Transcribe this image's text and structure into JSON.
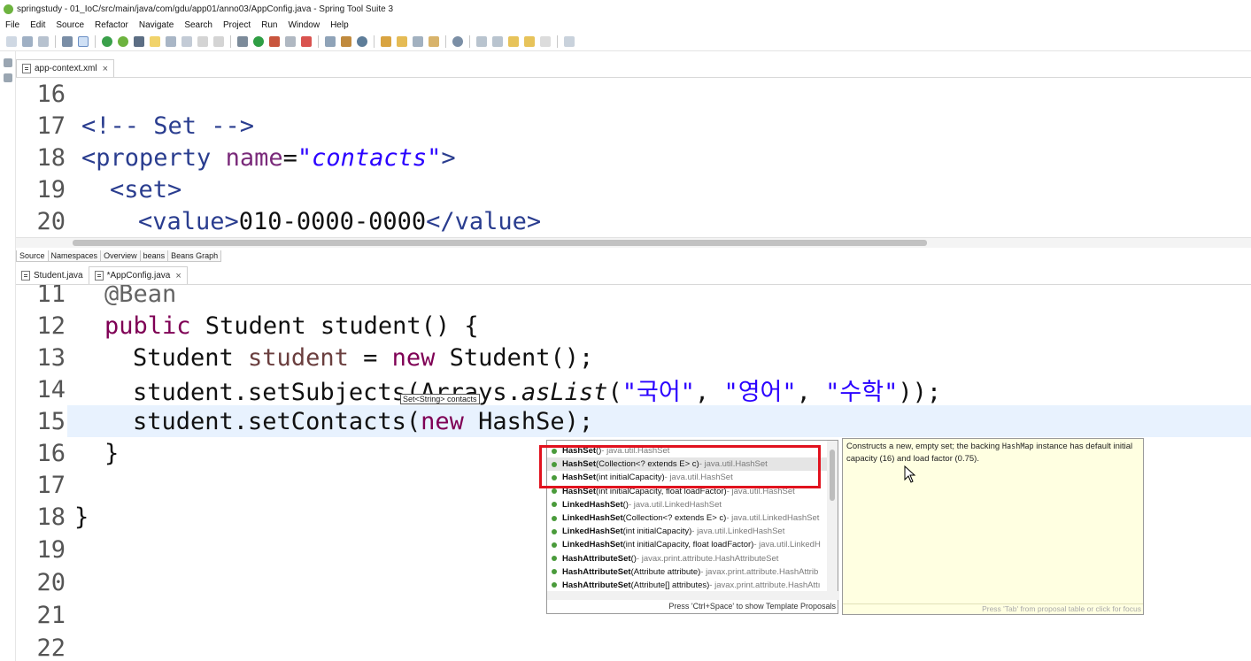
{
  "window": {
    "title": "springstudy - 01_IoC/src/main/java/com/gdu/app01/anno03/AppConfig.java - Spring Tool Suite 3"
  },
  "menu": [
    "File",
    "Edit",
    "Source",
    "Refactor",
    "Navigate",
    "Search",
    "Project",
    "Run",
    "Window",
    "Help"
  ],
  "top_editor": {
    "tab_label": "app-context.xml",
    "lines": [
      {
        "no": "16"
      },
      {
        "no": "17",
        "c1": "<!-- Set -->"
      },
      {
        "no": "18",
        "c1": "<property ",
        "c2": "name",
        "c3": "=",
        "c4": "\"contacts\"",
        "c5": ">"
      },
      {
        "no": "19",
        "c1": "<set>"
      },
      {
        "no": "20",
        "c1": "<value>",
        "c2": "010-0000-0000",
        "c3": "</value>"
      }
    ]
  },
  "design_tabs": [
    "Source",
    "Namespaces",
    "Overview",
    "beans",
    "Beans Graph"
  ],
  "bottom_tabs": [
    {
      "label": "Student.java",
      "active": false
    },
    {
      "label": "*AppConfig.java",
      "active": true
    }
  ],
  "java_lines": [
    {
      "no": "11",
      "anno": "@Bean"
    },
    {
      "no": "12",
      "kw": "public",
      "rest": " Student student() {"
    },
    {
      "no": "13",
      "t1": "Student ",
      "var": "student",
      "t2": " = ",
      "kw": "new",
      "t3": " Student();"
    },
    {
      "no": "14",
      "t1": "student.setSubjects(Arrays.",
      "it": "asList",
      "t2": "(",
      "s1": "\"국어\"",
      "t3": ", ",
      "s2": "\"영어\"",
      "t4": ", ",
      "s3": "\"수학\"",
      "t5": "));"
    },
    {
      "no": "15",
      "t1": "student.setContacts(",
      "kw": "new",
      "t2": " HashSe);"
    },
    {
      "no": "16",
      "t1": "}"
    },
    {
      "no": "17"
    },
    {
      "no": "18",
      "t1": "}"
    },
    {
      "no": "19"
    },
    {
      "no": "20"
    },
    {
      "no": "21"
    },
    {
      "no": "22"
    }
  ],
  "param_hint": "Set<String> contacts",
  "proposals": [
    {
      "name": "HashSet",
      "sig": "()",
      "qual": " - java.util.HashSet"
    },
    {
      "name": "HashSet",
      "sig": "(Collection<? extends E> c)",
      "qual": " - java.util.HashSet",
      "selected": true
    },
    {
      "name": "HashSet",
      "sig": "(int initialCapacity)",
      "qual": " - java.util.HashSet"
    },
    {
      "name": "HashSet",
      "sig": "(int initialCapacity, float loadFactor)",
      "qual": " - java.util.HashSet"
    },
    {
      "name": "LinkedHashSet",
      "sig": "()",
      "qual": " - java.util.LinkedHashSet"
    },
    {
      "name": "LinkedHashSet",
      "sig": "(Collection<? extends E> c)",
      "qual": " - java.util.LinkedHashSet"
    },
    {
      "name": "LinkedHashSet",
      "sig": "(int initialCapacity)",
      "qual": " - java.util.LinkedHashSet"
    },
    {
      "name": "LinkedHashSet",
      "sig": "(int initialCapacity, float loadFactor)",
      "qual": " - java.util.LinkedH"
    },
    {
      "name": "HashAttributeSet",
      "sig": "()",
      "qual": " - javax.print.attribute.HashAttributeSet"
    },
    {
      "name": "HashAttributeSet",
      "sig": "(Attribute attribute)",
      "qual": " - javax.print.attribute.HashAttrib"
    },
    {
      "name": "HashAttributeSet",
      "sig": "(Attribute[] attributes)",
      "qual": " - javax.print.attribute.HashAttı"
    }
  ],
  "proposals_footer": "Press 'Ctrl+Space' to show Template Proposals",
  "doc": {
    "t1": "Constructs a new, empty set; the backing ",
    "code": "HashMap",
    "t2": " instance has default initial capacity (16) and load factor (0.75).",
    "footer": "Press 'Tab' from proposal table or click for focus"
  },
  "colors": {
    "selection_box": "#e1121e",
    "line_highlight": "#e8f2fe",
    "doc_bg": "#ffffe1"
  }
}
